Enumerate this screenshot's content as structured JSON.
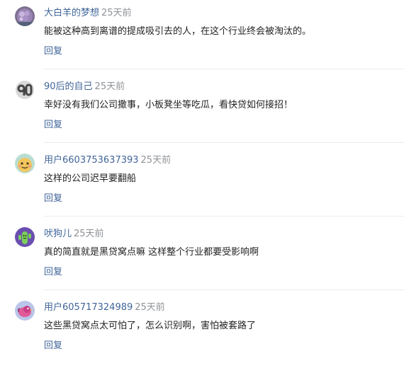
{
  "comments": [
    {
      "user": "大白羊的梦想",
      "time": "25天前",
      "text": "能被这种高到离谱的提成吸引去的人，在这个行业终会被淘汰的。",
      "reply": "回复",
      "avatar": "purple-flower-avatar-icon"
    },
    {
      "user": "90后的自己",
      "time": "25天前",
      "text": "幸好没有我们公司撒事，小板凳坐等吃瓜，看快贷如何接招！",
      "reply": "回复",
      "avatar": "grey-90-avatar-icon"
    },
    {
      "user": "用户6603753637393",
      "time": "25天前",
      "text": "这样的公司迟早要翻船",
      "reply": "回复",
      "avatar": "green-face-avatar-icon"
    },
    {
      "user": "吠狗儿",
      "time": "25天前",
      "text": "真的简直就是黑贷窝点嘛 这样整个行业都要受影响啊",
      "reply": "回复",
      "avatar": "cactus-avatar-icon"
    },
    {
      "user": "用户605717324989",
      "time": "25天前",
      "text": "这些黑贷窝点太可怕了，怎么识别啊，害怕被套路了",
      "reply": "回复",
      "avatar": "bird-avatar-icon"
    }
  ],
  "colors": {
    "link": "#406599",
    "muted": "#8f9297",
    "text": "#222222",
    "divider": "#ececec"
  }
}
